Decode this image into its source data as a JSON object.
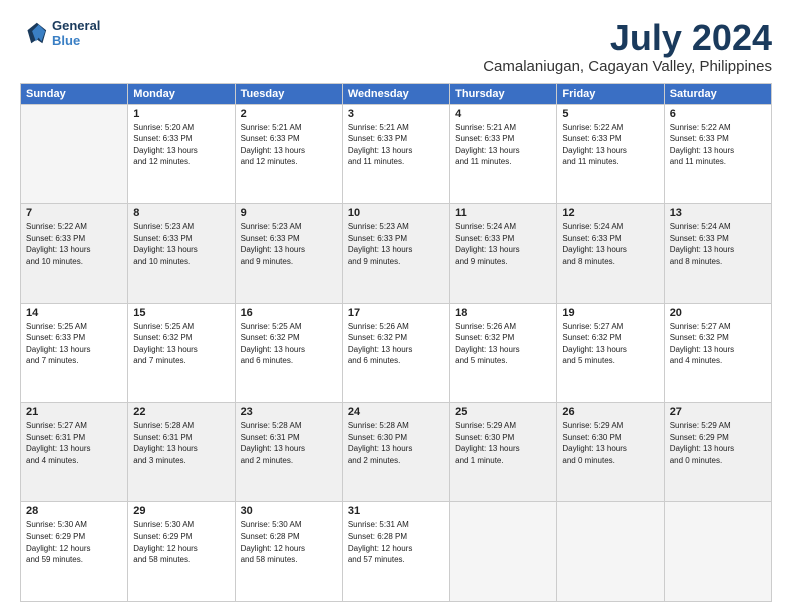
{
  "header": {
    "logo_line1": "General",
    "logo_line2": "Blue",
    "title": "July 2024",
    "subtitle": "Camalaniugan, Cagayan Valley, Philippines"
  },
  "columns": [
    "Sunday",
    "Monday",
    "Tuesday",
    "Wednesday",
    "Thursday",
    "Friday",
    "Saturday"
  ],
  "weeks": [
    [
      {
        "day": "",
        "info": ""
      },
      {
        "day": "1",
        "info": "Sunrise: 5:20 AM\nSunset: 6:33 PM\nDaylight: 13 hours\nand 12 minutes."
      },
      {
        "day": "2",
        "info": "Sunrise: 5:21 AM\nSunset: 6:33 PM\nDaylight: 13 hours\nand 12 minutes."
      },
      {
        "day": "3",
        "info": "Sunrise: 5:21 AM\nSunset: 6:33 PM\nDaylight: 13 hours\nand 11 minutes."
      },
      {
        "day": "4",
        "info": "Sunrise: 5:21 AM\nSunset: 6:33 PM\nDaylight: 13 hours\nand 11 minutes."
      },
      {
        "day": "5",
        "info": "Sunrise: 5:22 AM\nSunset: 6:33 PM\nDaylight: 13 hours\nand 11 minutes."
      },
      {
        "day": "6",
        "info": "Sunrise: 5:22 AM\nSunset: 6:33 PM\nDaylight: 13 hours\nand 11 minutes."
      }
    ],
    [
      {
        "day": "7",
        "info": "Sunrise: 5:22 AM\nSunset: 6:33 PM\nDaylight: 13 hours\nand 10 minutes."
      },
      {
        "day": "8",
        "info": "Sunrise: 5:23 AM\nSunset: 6:33 PM\nDaylight: 13 hours\nand 10 minutes."
      },
      {
        "day": "9",
        "info": "Sunrise: 5:23 AM\nSunset: 6:33 PM\nDaylight: 13 hours\nand 9 minutes."
      },
      {
        "day": "10",
        "info": "Sunrise: 5:23 AM\nSunset: 6:33 PM\nDaylight: 13 hours\nand 9 minutes."
      },
      {
        "day": "11",
        "info": "Sunrise: 5:24 AM\nSunset: 6:33 PM\nDaylight: 13 hours\nand 9 minutes."
      },
      {
        "day": "12",
        "info": "Sunrise: 5:24 AM\nSunset: 6:33 PM\nDaylight: 13 hours\nand 8 minutes."
      },
      {
        "day": "13",
        "info": "Sunrise: 5:24 AM\nSunset: 6:33 PM\nDaylight: 13 hours\nand 8 minutes."
      }
    ],
    [
      {
        "day": "14",
        "info": "Sunrise: 5:25 AM\nSunset: 6:33 PM\nDaylight: 13 hours\nand 7 minutes."
      },
      {
        "day": "15",
        "info": "Sunrise: 5:25 AM\nSunset: 6:32 PM\nDaylight: 13 hours\nand 7 minutes."
      },
      {
        "day": "16",
        "info": "Sunrise: 5:25 AM\nSunset: 6:32 PM\nDaylight: 13 hours\nand 6 minutes."
      },
      {
        "day": "17",
        "info": "Sunrise: 5:26 AM\nSunset: 6:32 PM\nDaylight: 13 hours\nand 6 minutes."
      },
      {
        "day": "18",
        "info": "Sunrise: 5:26 AM\nSunset: 6:32 PM\nDaylight: 13 hours\nand 5 minutes."
      },
      {
        "day": "19",
        "info": "Sunrise: 5:27 AM\nSunset: 6:32 PM\nDaylight: 13 hours\nand 5 minutes."
      },
      {
        "day": "20",
        "info": "Sunrise: 5:27 AM\nSunset: 6:32 PM\nDaylight: 13 hours\nand 4 minutes."
      }
    ],
    [
      {
        "day": "21",
        "info": "Sunrise: 5:27 AM\nSunset: 6:31 PM\nDaylight: 13 hours\nand 4 minutes."
      },
      {
        "day": "22",
        "info": "Sunrise: 5:28 AM\nSunset: 6:31 PM\nDaylight: 13 hours\nand 3 minutes."
      },
      {
        "day": "23",
        "info": "Sunrise: 5:28 AM\nSunset: 6:31 PM\nDaylight: 13 hours\nand 2 minutes."
      },
      {
        "day": "24",
        "info": "Sunrise: 5:28 AM\nSunset: 6:30 PM\nDaylight: 13 hours\nand 2 minutes."
      },
      {
        "day": "25",
        "info": "Sunrise: 5:29 AM\nSunset: 6:30 PM\nDaylight: 13 hours\nand 1 minute."
      },
      {
        "day": "26",
        "info": "Sunrise: 5:29 AM\nSunset: 6:30 PM\nDaylight: 13 hours\nand 0 minutes."
      },
      {
        "day": "27",
        "info": "Sunrise: 5:29 AM\nSunset: 6:29 PM\nDaylight: 13 hours\nand 0 minutes."
      }
    ],
    [
      {
        "day": "28",
        "info": "Sunrise: 5:30 AM\nSunset: 6:29 PM\nDaylight: 12 hours\nand 59 minutes."
      },
      {
        "day": "29",
        "info": "Sunrise: 5:30 AM\nSunset: 6:29 PM\nDaylight: 12 hours\nand 58 minutes."
      },
      {
        "day": "30",
        "info": "Sunrise: 5:30 AM\nSunset: 6:28 PM\nDaylight: 12 hours\nand 58 minutes."
      },
      {
        "day": "31",
        "info": "Sunrise: 5:31 AM\nSunset: 6:28 PM\nDaylight: 12 hours\nand 57 minutes."
      },
      {
        "day": "",
        "info": ""
      },
      {
        "day": "",
        "info": ""
      },
      {
        "day": "",
        "info": ""
      }
    ]
  ]
}
